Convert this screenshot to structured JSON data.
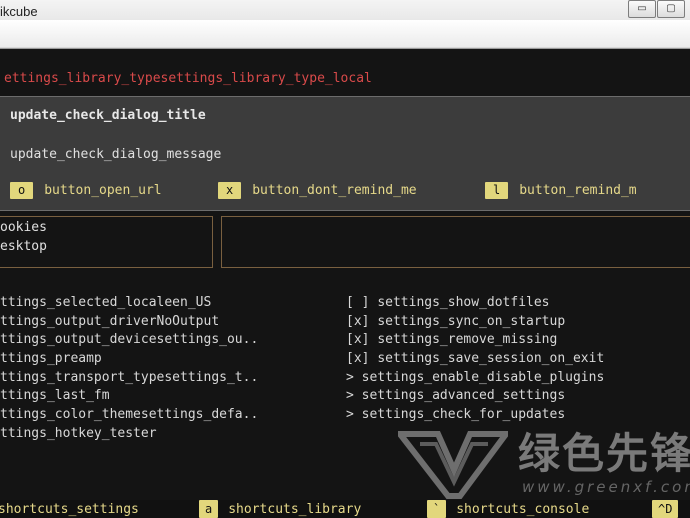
{
  "window": {
    "title": "ikcube",
    "minimize_glyph": "▭",
    "maximize_glyph": "▢"
  },
  "breadcrumb": "ettings_library_typesettings_library_type_local",
  "dialog": {
    "title": "update_check_dialog_title",
    "message": "update_check_dialog_message",
    "buttons": [
      {
        "key": "o",
        "label": "button_open_url"
      },
      {
        "key": "x",
        "label": "button_dont_remind_me"
      },
      {
        "key": "l",
        "label": "button_remind_m"
      }
    ]
  },
  "directories": [
    "ookies",
    "esktop"
  ],
  "settings_left": [
    "ttings_selected_localeen_US",
    "ttings_output_driverNoOutput",
    "ttings_output_devicesettings_ou..",
    "ttings_preamp",
    "ttings_transport_typesettings_t..",
    "ttings_last_fm",
    "ttings_color_themesettings_defa..",
    "ttings_hotkey_tester"
  ],
  "settings_right": [
    {
      "marker": "[ ]",
      "label": "settings_show_dotfiles"
    },
    {
      "marker": "[x]",
      "label": "settings_sync_on_startup"
    },
    {
      "marker": "[x]",
      "label": "settings_remove_missing"
    },
    {
      "marker": "[x]",
      "label": "settings_save_session_on_exit"
    },
    {
      "marker": ">",
      "label": "settings_enable_disable_plugins"
    },
    {
      "marker": ">",
      "label": "settings_advanced_settings"
    },
    {
      "marker": ">",
      "label": "settings_check_for_updates"
    }
  ],
  "shortcuts": [
    {
      "key": "",
      "label": "shortcuts_settings"
    },
    {
      "key": "a",
      "label": "shortcuts_library"
    },
    {
      "key": "`",
      "label": "shortcuts_console"
    },
    {
      "key": "^D",
      "label": ""
    }
  ],
  "watermark": {
    "text": "绿色先锋",
    "url": "www.greenxf.com"
  },
  "colors": {
    "background": "#141414",
    "breadcrumb": "#d94a4a",
    "dialog_bg": "#3c3c3c",
    "key_bg": "#e2d77c",
    "key_label": "#e6d98a"
  }
}
